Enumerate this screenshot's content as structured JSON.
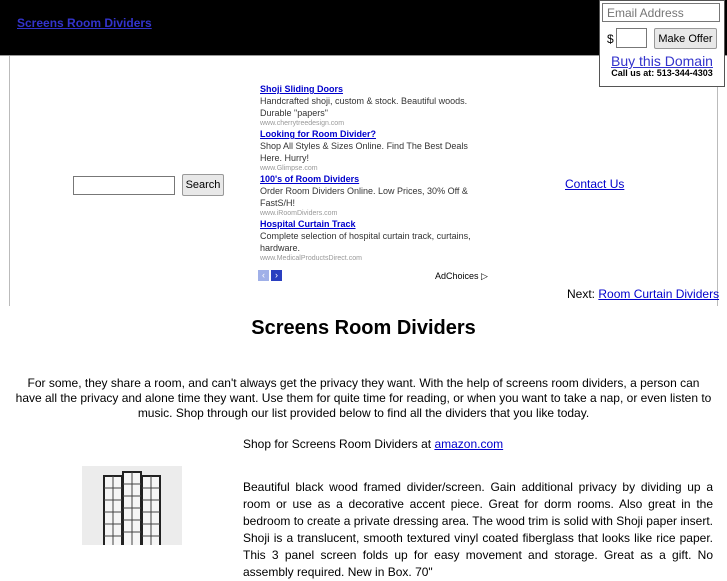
{
  "header": {
    "site_title": "Screens Room Dividers"
  },
  "offer_widget": {
    "email_placeholder": "Email Address",
    "currency_symbol": "$",
    "amount_value": "",
    "make_offer_label": "Make Offer",
    "buy_label": "Buy this Domain",
    "call_text": "Call us at: 513-344-4303"
  },
  "search": {
    "input_value": "",
    "button_label": "Search"
  },
  "ads": {
    "items": [
      {
        "title": "Shoji Sliding Doors",
        "description": "Handcrafted shoji, custom & stock. Beautiful woods. Durable \"papers\"",
        "url": "www.cherrytreedesign.com"
      },
      {
        "title": "Looking for Room Divider?",
        "description": "Shop All Styles & Sizes Online. Find The Best Deals Here. Hurry!",
        "url": "www.Glimpse.com"
      },
      {
        "title": "100's of Room Dividers",
        "description": "Order Room Dividers Online. Low Prices, 30% Off & FastS/H!",
        "url": "www.iRoomDividers.com"
      },
      {
        "title": "Hospital Curtain Track",
        "description": "Complete selection of hospital curtain track, curtains, hardware.",
        "url": "www.MedicalProductsDirect.com"
      }
    ],
    "prev_icon": "‹",
    "next_icon": "›",
    "adchoices_label": "AdChoices",
    "adchoices_icon": "▷"
  },
  "nav": {
    "contact_label": "Contact Us",
    "next_prefix": "Next:",
    "next_link": "Room Curtain Dividers"
  },
  "main": {
    "title": "Screens Room Dividers",
    "intro": "For some, they share a room, and can't always get the privacy they want. With the help of screens room dividers, a person can have all the privacy and alone time they want. Use them for quite time for reading, or when you want to take a nap, or even listen to music. Shop through our list provided below to find all the dividers that you like today.",
    "shop_prefix": "Shop for Screens Room Dividers at",
    "shop_link": "amazon.com",
    "product_description": "Beautiful black wood framed divider/screen. Gain additional privacy by dividing up a room or use as a decorative accent piece. Great for dorm rooms. Also great in the bedroom to create a private dressing area. The wood trim is solid with Shoji paper insert. Shoji is a translucent, smooth textured vinyl coated fiberglass that looks like rice paper. This 3 panel screen folds up for easy movement and storage. Great as a gift. No assembly required. New in Box. 70\""
  }
}
